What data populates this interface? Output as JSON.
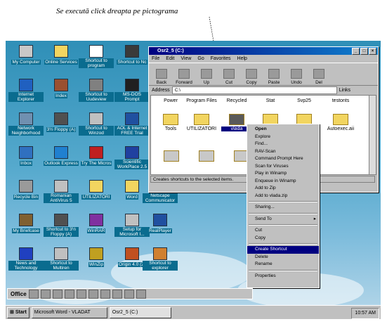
{
  "caption": "Se execută click dreapta pe pictograma",
  "desktop_icons": [
    {
      "label": "My Computer",
      "color": "#c8c8c8"
    },
    {
      "label": "Online Services",
      "color": "#f2d560"
    },
    {
      "label": "Shortcut to program",
      "color": "#ffffff"
    },
    {
      "label": "Shortcut to Nc",
      "color": "#3a3a3a"
    },
    {
      "label": "Internet Explorer",
      "color": "#2060c0"
    },
    {
      "label": "Index",
      "color": "#9a5030"
    },
    {
      "label": "Shortcut to Uudeview",
      "color": "#808080"
    },
    {
      "label": "MS-DOS Prompt",
      "color": "#202020"
    },
    {
      "label": "Network Neighborhood",
      "color": "#7090b0"
    },
    {
      "label": "3½ Floppy (A)",
      "color": "#505050"
    },
    {
      "label": "Shortcut to Winzod",
      "color": "#c0c0c0"
    },
    {
      "label": "AOL & Internet FREE Trial",
      "color": "#2050a0"
    },
    {
      "label": "Inbox",
      "color": "#3070c0"
    },
    {
      "label": "Outlook Express",
      "color": "#2080d0"
    },
    {
      "label": "Try The Micros",
      "color": "#c02020"
    },
    {
      "label": "Scientific WorkPlace 2.5",
      "color": "#2040a0"
    },
    {
      "label": "Recycle Bin",
      "color": "#9a9a9a"
    },
    {
      "label": "Romanian AntiVirus 5",
      "color": "#c0c0c0"
    },
    {
      "label": "UTILIZATORI",
      "color": "#f2d560"
    },
    {
      "label": "Word",
      "color": "#f2d560"
    },
    {
      "label": "Netscape Communicator",
      "color": "#408040"
    },
    {
      "label": "My Briefcase",
      "color": "#806030"
    },
    {
      "label": "Shortcut to 3½ Floppy (A)",
      "color": "#505050"
    },
    {
      "label": "WinRAR",
      "color": "#8030a0"
    },
    {
      "label": "Setup for Microsoft I...",
      "color": "#c0c0c0"
    },
    {
      "label": "RealPlayer",
      "color": "#2050a0"
    },
    {
      "label": "News and Technology",
      "color": "#2040c0"
    },
    {
      "label": "Shortcut to Multiren",
      "color": "#c0c0c0"
    },
    {
      "label": "WinZip",
      "color": "#c0a020"
    },
    {
      "label": "Origin 4.0 (2)",
      "color": "#c05020"
    },
    {
      "label": "Shortcut to explorer",
      "color": "#d08030"
    }
  ],
  "window": {
    "title": "Osr2_5 (C:)",
    "menu": [
      "File",
      "Edit",
      "View",
      "Go",
      "Favorites",
      "Help"
    ],
    "toolbar": [
      "Back",
      "Forward",
      "Up",
      "Cut",
      "Copy",
      "Paste",
      "Undo",
      "Del"
    ],
    "address_label": "Address",
    "address_value": "C:\\",
    "links_label": "Links",
    "row1": [
      "Power",
      "Program Files",
      "Recycled",
      "Stat",
      "Svp25",
      "testonts"
    ],
    "row2": [
      "Tools",
      "UTILIZATORI",
      "vlada",
      "",
      "",
      "Autoexec.aii"
    ],
    "status": "Creates shortcuts to the selected items."
  },
  "context_menu": [
    {
      "label": "Open",
      "bold": true
    },
    {
      "label": "Explore"
    },
    {
      "label": "Find..."
    },
    {
      "label": "RAV-Scan"
    },
    {
      "label": "Command Prompt Here"
    },
    {
      "label": "Scan for Viruses"
    },
    {
      "label": "Play in Winamp"
    },
    {
      "label": "Enqueue in Winamp"
    },
    {
      "label": "Add to Zip"
    },
    {
      "label": "Add to vlada.zip"
    },
    {
      "sep": true
    },
    {
      "label": "Sharing..."
    },
    {
      "sep": true
    },
    {
      "label": "Send To",
      "submenu": true
    },
    {
      "sep": true
    },
    {
      "label": "Cut"
    },
    {
      "label": "Copy"
    },
    {
      "sep": true
    },
    {
      "label": "Create Shortcut",
      "selected": true
    },
    {
      "label": "Delete"
    },
    {
      "label": "Rename"
    },
    {
      "sep": true
    },
    {
      "label": "Properties"
    }
  ],
  "office_bar": {
    "label": "Office"
  },
  "taskbar": {
    "start": "Start",
    "tasks": [
      "Microsoft Word - VLADAT",
      "Osr2_5 (C:)"
    ],
    "clock": "10:57 AM"
  }
}
